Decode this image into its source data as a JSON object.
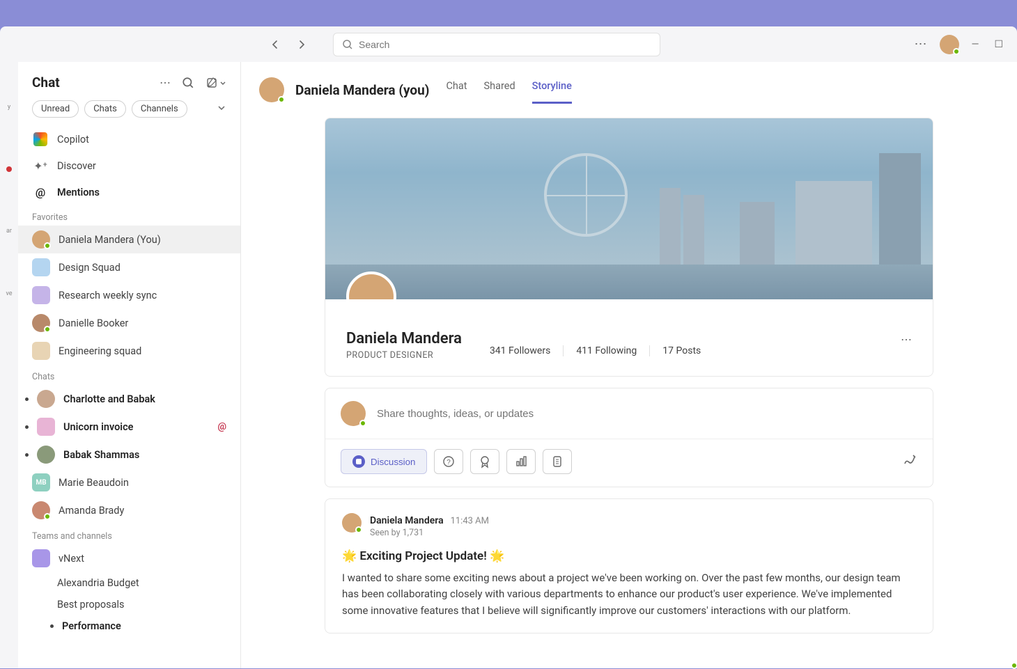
{
  "search": {
    "placeholder": "Search"
  },
  "sidebar": {
    "title": "Chat",
    "filters": {
      "unread": "Unread",
      "chats": "Chats",
      "channels": "Channels"
    },
    "quick": {
      "copilot": "Copilot",
      "discover": "Discover",
      "mentions": "Mentions"
    },
    "sections": {
      "favorites": "Favorites",
      "chats": "Chats",
      "teams": "Teams and channels"
    },
    "favorites": [
      {
        "label": "Daniela Mandera (You)"
      },
      {
        "label": "Design Squad"
      },
      {
        "label": "Research weekly sync"
      },
      {
        "label": "Danielle Booker"
      },
      {
        "label": "Engineering squad"
      }
    ],
    "chats_items": [
      {
        "label": "Charlotte and Babak",
        "bold": true,
        "bullet": true
      },
      {
        "label": "Unicorn invoice",
        "bold": true,
        "bullet": true,
        "mention": true
      },
      {
        "label": "Babak Shammas",
        "bold": true,
        "bullet": true
      },
      {
        "label": "Marie Beaudoin"
      },
      {
        "label": "Amanda Brady"
      }
    ],
    "teams_items": [
      {
        "label": "vNext"
      },
      {
        "label": "Alexandria Budget",
        "indent": true
      },
      {
        "label": "Best proposals",
        "indent": true
      },
      {
        "label": "Performance",
        "indent": true,
        "bold": true,
        "bullet": true
      }
    ]
  },
  "rail": {
    "item1": "y",
    "item2": "ar",
    "item3": "ve"
  },
  "header": {
    "name": "Daniela Mandera (you)",
    "tabs": {
      "chat": "Chat",
      "shared": "Shared",
      "storyline": "Storyline"
    }
  },
  "profile": {
    "name": "Daniela Mandera",
    "role": "PRODUCT DESIGNER",
    "followers": "341 Followers",
    "following": "411 Following",
    "posts": "17 Posts"
  },
  "composer": {
    "placeholder": "Share thoughts, ideas, or updates",
    "discussion": "Discussion"
  },
  "post": {
    "author": "Daniela Mandera",
    "time": "11:43 AM",
    "seen": "Seen by 1,731",
    "title": "🌟 Exciting Project Update! 🌟",
    "body": "I wanted to share some exciting news about a project we've been working on. Over the past few months, our design team has been collaborating closely with various departments to enhance our product's user experience. We've implemented some innovative features that I believe will significantly improve our customers' interactions with our platform."
  }
}
